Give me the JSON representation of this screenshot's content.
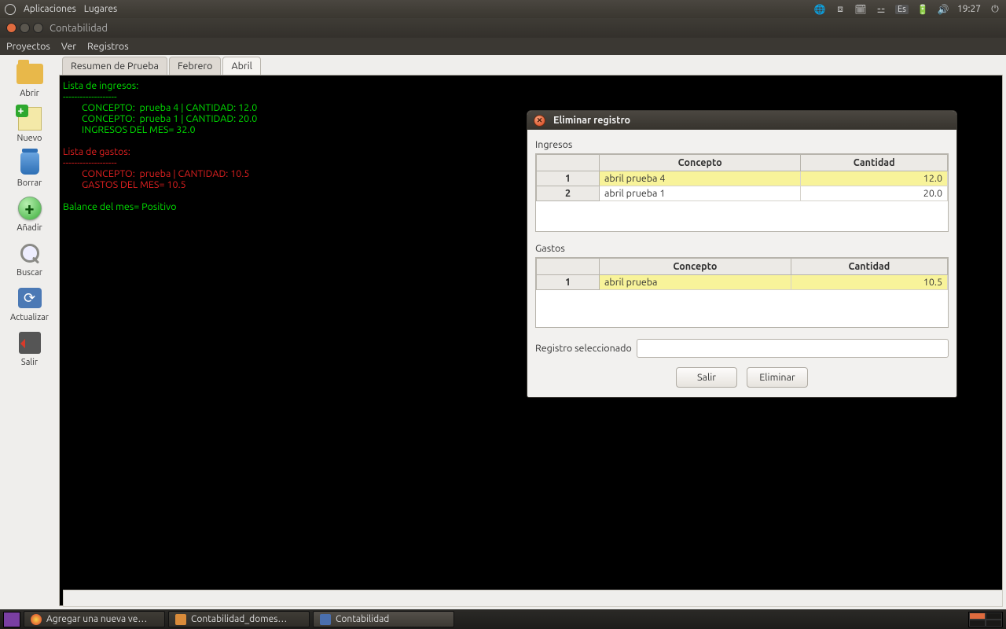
{
  "topbar": {
    "apps": "Aplicaciones",
    "places": "Lugares",
    "kb": "Es",
    "time": "19:27"
  },
  "window": {
    "title": "Contabilidad"
  },
  "menubar": {
    "proyectos": "Proyectos",
    "ver": "Ver",
    "registros": "Registros"
  },
  "sidebar": {
    "abrir": "Abrir",
    "nuevo": "Nuevo",
    "borrar": "Borrar",
    "anadir": "Añadir",
    "buscar": "Buscar",
    "actualizar": "Actualizar",
    "salir": "Salir"
  },
  "tabs": {
    "t0": "Resumen de Prueba",
    "t1": "Febrero",
    "t2": "Abril"
  },
  "terminal": {
    "ingresos_header": "Lista de ingresos:",
    "ingresos_sep": "-------------------",
    "ing1": "CONCEPTO:  prueba 4 | CANTIDAD: 12.0",
    "ing2": "CONCEPTO:  prueba 1 | CANTIDAD: 20.0",
    "ing_total": "INGRESOS DEL MES= 32.0",
    "gastos_header": "Lista de gastos:",
    "gastos_sep": "-------------------",
    "gas1": "CONCEPTO:  prueba | CANTIDAD: 10.5",
    "gas_total": "GASTOS DEL MES= 10.5",
    "balance": "Balance del mes= Positivo"
  },
  "dialog": {
    "title": "Eliminar registro",
    "ingresos_label": "Ingresos",
    "gastos_label": "Gastos",
    "col_concepto": "Concepto",
    "col_cantidad": "Cantidad",
    "ingresos": [
      {
        "idx": "1",
        "concepto": "abril prueba 4",
        "cantidad": "12.0"
      },
      {
        "idx": "2",
        "concepto": "abril prueba 1",
        "cantidad": "20.0"
      }
    ],
    "gastos": [
      {
        "idx": "1",
        "concepto": "abril prueba",
        "cantidad": "10.5"
      }
    ],
    "reg_label": "Registro seleccionado",
    "btn_salir": "Salir",
    "btn_eliminar": "Eliminar"
  },
  "taskbar": {
    "t0": "Agregar una nueva ve…",
    "t1": "Contabilidad_domes…",
    "t2": "Contabilidad"
  }
}
